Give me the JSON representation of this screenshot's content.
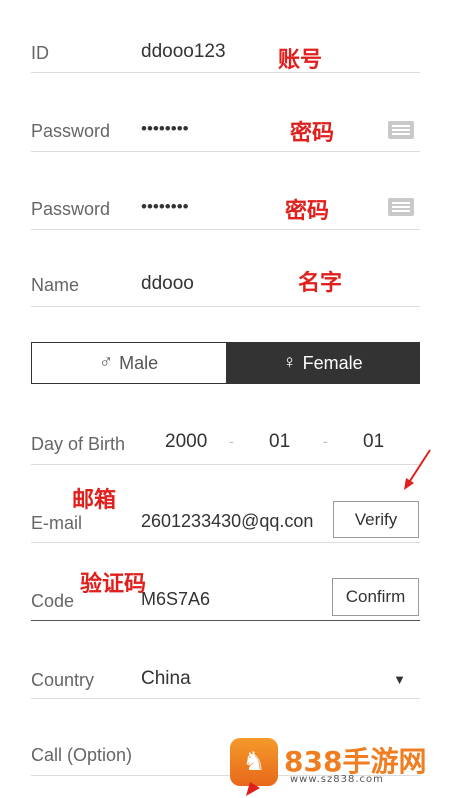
{
  "form": {
    "id": {
      "label": "ID",
      "value": "ddooo123",
      "annotation": "账号"
    },
    "password": {
      "label": "Password",
      "value": "••••••••",
      "annotation": "密码"
    },
    "password_confirm": {
      "label": "Password",
      "value": "••••••••",
      "annotation": "密码"
    },
    "name": {
      "label": "Name",
      "value": "ddooo",
      "annotation": "名字"
    },
    "gender": {
      "male_label": "Male",
      "female_label": "Female",
      "selected": "Female"
    },
    "dob": {
      "label": "Day of Birth",
      "year": "2000",
      "month": "01",
      "day": "01",
      "separator": "-"
    },
    "email": {
      "label": "E-mail",
      "value": "2601233430@qq.con",
      "annotation": "邮箱",
      "button": "Verify"
    },
    "code": {
      "label": "Code",
      "value": "M6S7A6",
      "annotation": "验证码",
      "button": "Confirm"
    },
    "country": {
      "label": "Country",
      "value": "China"
    },
    "call": {
      "label": "Call (Option)"
    }
  },
  "watermark": {
    "title": "838手游网",
    "url": "www.sz838.com"
  },
  "colors": {
    "annotation": "#e0201c",
    "selected_bg": "#333333",
    "logo": "#f07d1f"
  }
}
